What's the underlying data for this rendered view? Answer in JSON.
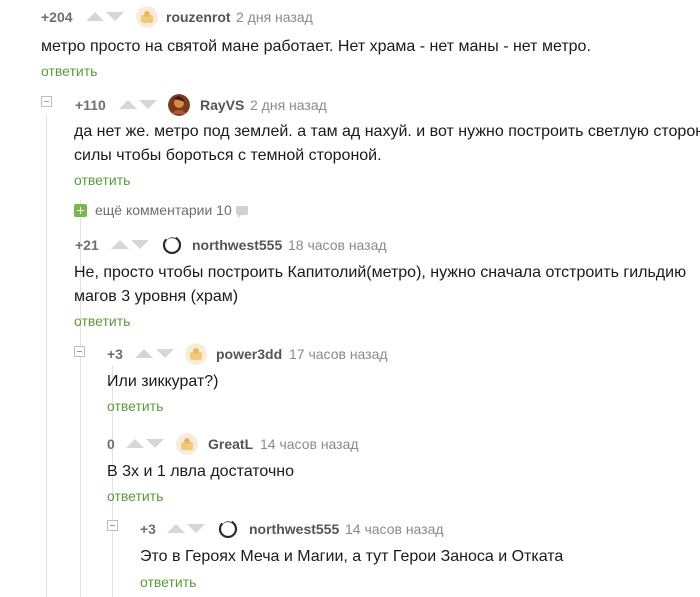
{
  "comments": [
    {
      "rating": "+204",
      "user": "rouzenrot",
      "time": "2 дня назад",
      "text": "метро просто на святой мане работает. Нет храма - нет маны - нет метро.",
      "reply": "ответить",
      "avatar": "placeholder-avatar-icon"
    },
    {
      "rating": "+110",
      "user": "RayVS",
      "time": "2 дня назад",
      "text_lines": [
        "да нет же. метро под землей. а там ад нахуй. и вот нужно построить светлую сторону",
        "силы чтобы бороться с темной стороной."
      ],
      "reply": "ответить",
      "avatar": "user-photo-avatar"
    },
    {
      "rating": "+21",
      "user": "northwest555",
      "time": "18 часов назад",
      "text_lines": [
        "Не, просто чтобы построить Капитолий(метро), нужно сначала отстроить гильдию",
        "магов 3 уровня (храм)"
      ],
      "reply": "ответить",
      "avatar": "ring-avatar-icon"
    },
    {
      "rating": "+3",
      "user": "power3dd",
      "time": "17 часов назад",
      "text": "Или зиккурат?)",
      "reply": "ответить",
      "avatar": "placeholder-avatar-icon"
    },
    {
      "rating": "0",
      "user": "GreatL",
      "time": "14 часов назад",
      "text": "В 3х и 1 лвла достаточно",
      "reply": "ответить",
      "avatar": "placeholder-avatar-icon"
    },
    {
      "rating": "+3",
      "user": "northwest555",
      "time": "14 часов назад",
      "text": "Это в Героях Меча и Магии, а тут Герои Заноса и Отката",
      "reply": "ответить",
      "avatar": "ring-avatar-icon"
    }
  ],
  "more_comments": {
    "label": "ещё комментарии 10"
  },
  "colors": {
    "reply": "#5b9a3c",
    "more_plus": "#78b84f",
    "arrow": "#d6d6d6"
  }
}
